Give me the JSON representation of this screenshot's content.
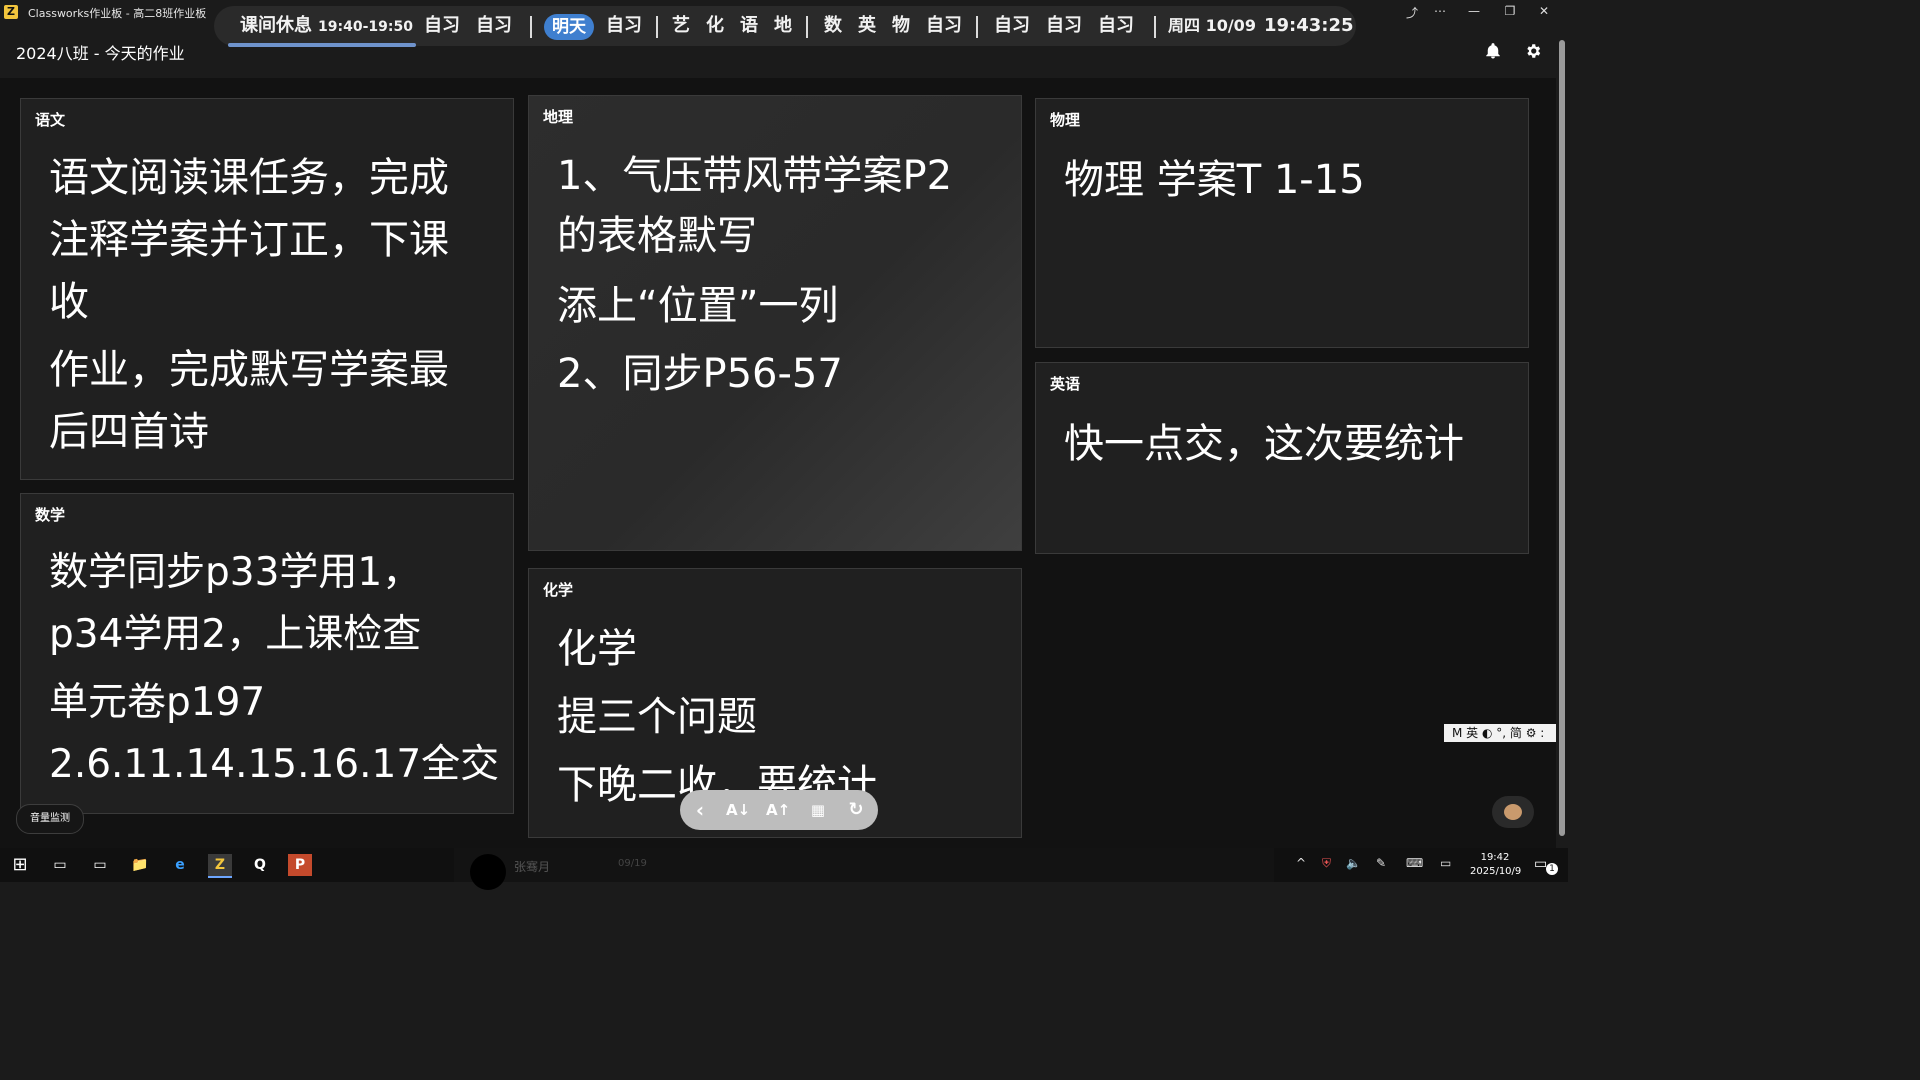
{
  "window": {
    "app_title": "Classworks作业板 - 高二8班作业板",
    "app_icon_letter": "Z",
    "controls": [
      "⤴",
      "⋯",
      "—",
      "❐",
      "✕"
    ]
  },
  "schedule": {
    "current_label": "课间休息",
    "current_time": "19:40-19:50",
    "today_periods": [
      "自习",
      "自习"
    ],
    "tomorrow_label": "明天",
    "tomorrow_periods_a": [
      "自习"
    ],
    "tomorrow_periods_b": [
      "艺",
      "化",
      "语",
      "地"
    ],
    "tomorrow_periods_c": [
      "数",
      "英",
      "物",
      "自习"
    ],
    "tomorrow_periods_d": [
      "自习",
      "自习",
      "自习"
    ],
    "weekday_date": "周四 10/09",
    "clock": "19:43:25"
  },
  "header": {
    "title": "2024八班 - 今天的作业",
    "bell_icon": "bell-icon",
    "settings_icon": "gear-icon"
  },
  "cards": {
    "chinese": {
      "subject": "语文",
      "lines": [
        "语文阅读课任务，完成",
        "注释学案并订正，下课",
        "收",
        "作业，完成默写学案最",
        "后四首诗"
      ]
    },
    "geography": {
      "subject": "地理",
      "lines": [
        "1、气压带风带学案P2",
        "的表格默写",
        "添上“位置”一列",
        "2、同步P56-57"
      ]
    },
    "physics": {
      "subject": "物理",
      "lines": [
        "物理 学案T 1-15"
      ]
    },
    "english": {
      "subject": "英语",
      "lines": [
        "快一点交，这次要统计"
      ]
    },
    "math": {
      "subject": "数学",
      "lines": [
        "数学同步p33学用1，",
        "p34学用2，上课检查",
        "单元卷p197",
        "2.6.11.14.15.16.17全交"
      ]
    },
    "chemistry": {
      "subject": "化学",
      "lines": [
        "化学",
        "提三个问题",
        "下晚二收，要统计"
      ]
    }
  },
  "toolbar": {
    "back": "‹",
    "font_smaller": "A↓",
    "font_larger": "A↑",
    "calendar": "▦",
    "refresh": "↻"
  },
  "volume_monitor_label": "音量监测",
  "ime": {
    "label": "M 英 ◐ °, 简 ⚙ :"
  },
  "taskbar": {
    "start": "⊞",
    "task_view": "▭",
    "apps": [
      "▭",
      "📁",
      "e",
      "Z",
      "Q",
      "P"
    ],
    "user_name": "张骞月",
    "user_date": "09/19",
    "tray": [
      "^",
      "⛨",
      "🔈",
      "✎",
      "⌨",
      "▭"
    ],
    "time": "19:42",
    "date": "2025/10/9",
    "notification_count": "1"
  }
}
